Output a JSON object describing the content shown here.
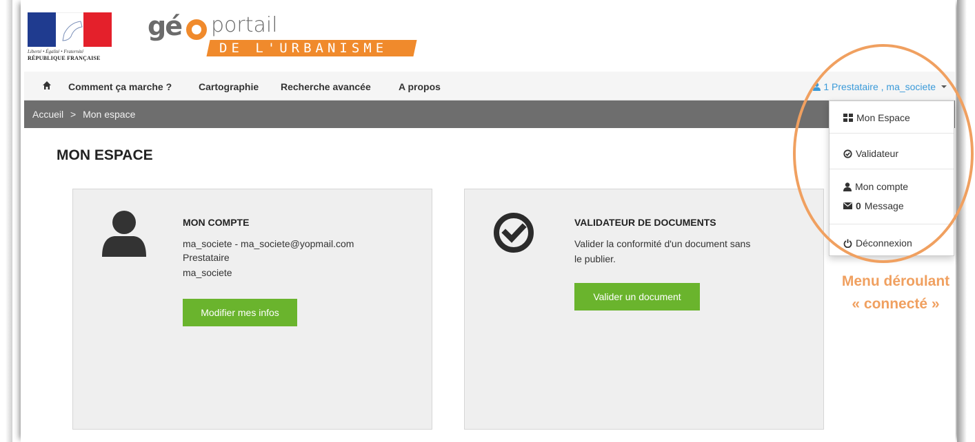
{
  "header": {
    "rf_devise": "Liberté • Égalité • Fraternité",
    "rf_name": "RÉPUBLIQUE FRANÇAISE",
    "logo_ge": "gé",
    "logo_portail": "portail",
    "logo_urbanisme": "De L'URBanIsme"
  },
  "nav": {
    "items": [
      "Comment ça marche ?",
      "Cartographie",
      "Recherche avancée",
      "A propos"
    ],
    "user_label": "1 Prestataire , ma_societe"
  },
  "breadcrumb": {
    "home": "Accueil",
    "separator": ">",
    "current": "Mon espace"
  },
  "page": {
    "title": "MON ESPACE"
  },
  "account_card": {
    "title": "MON COMPTE",
    "line1": "ma_societe - ma_societe@yopmail.com",
    "line2": "Prestataire",
    "line3": "ma_societe",
    "button": "Modifier mes infos"
  },
  "validator_card": {
    "title": "VALIDATEUR DE DOCUMENTS",
    "line1": "Valider la conformité d'un document sans",
    "line2": "le publier.",
    "button": "Valider un document"
  },
  "dropdown": {
    "mon_espace": "Mon Espace",
    "validateur": "Validateur",
    "mon_compte": "Mon compte",
    "message_count": "0",
    "message_label": "Message",
    "deconnexion": "Déconnexion"
  },
  "annotation": {
    "line1": "Menu déroulant",
    "line2": "« connecté »"
  },
  "colors": {
    "accent_orange": "#f08a2c",
    "annotation_orange": "#f0a060",
    "button_green": "#6ab42d",
    "link_blue": "#3a9ad9",
    "breadcrumb_grey": "#6e6e6e"
  }
}
